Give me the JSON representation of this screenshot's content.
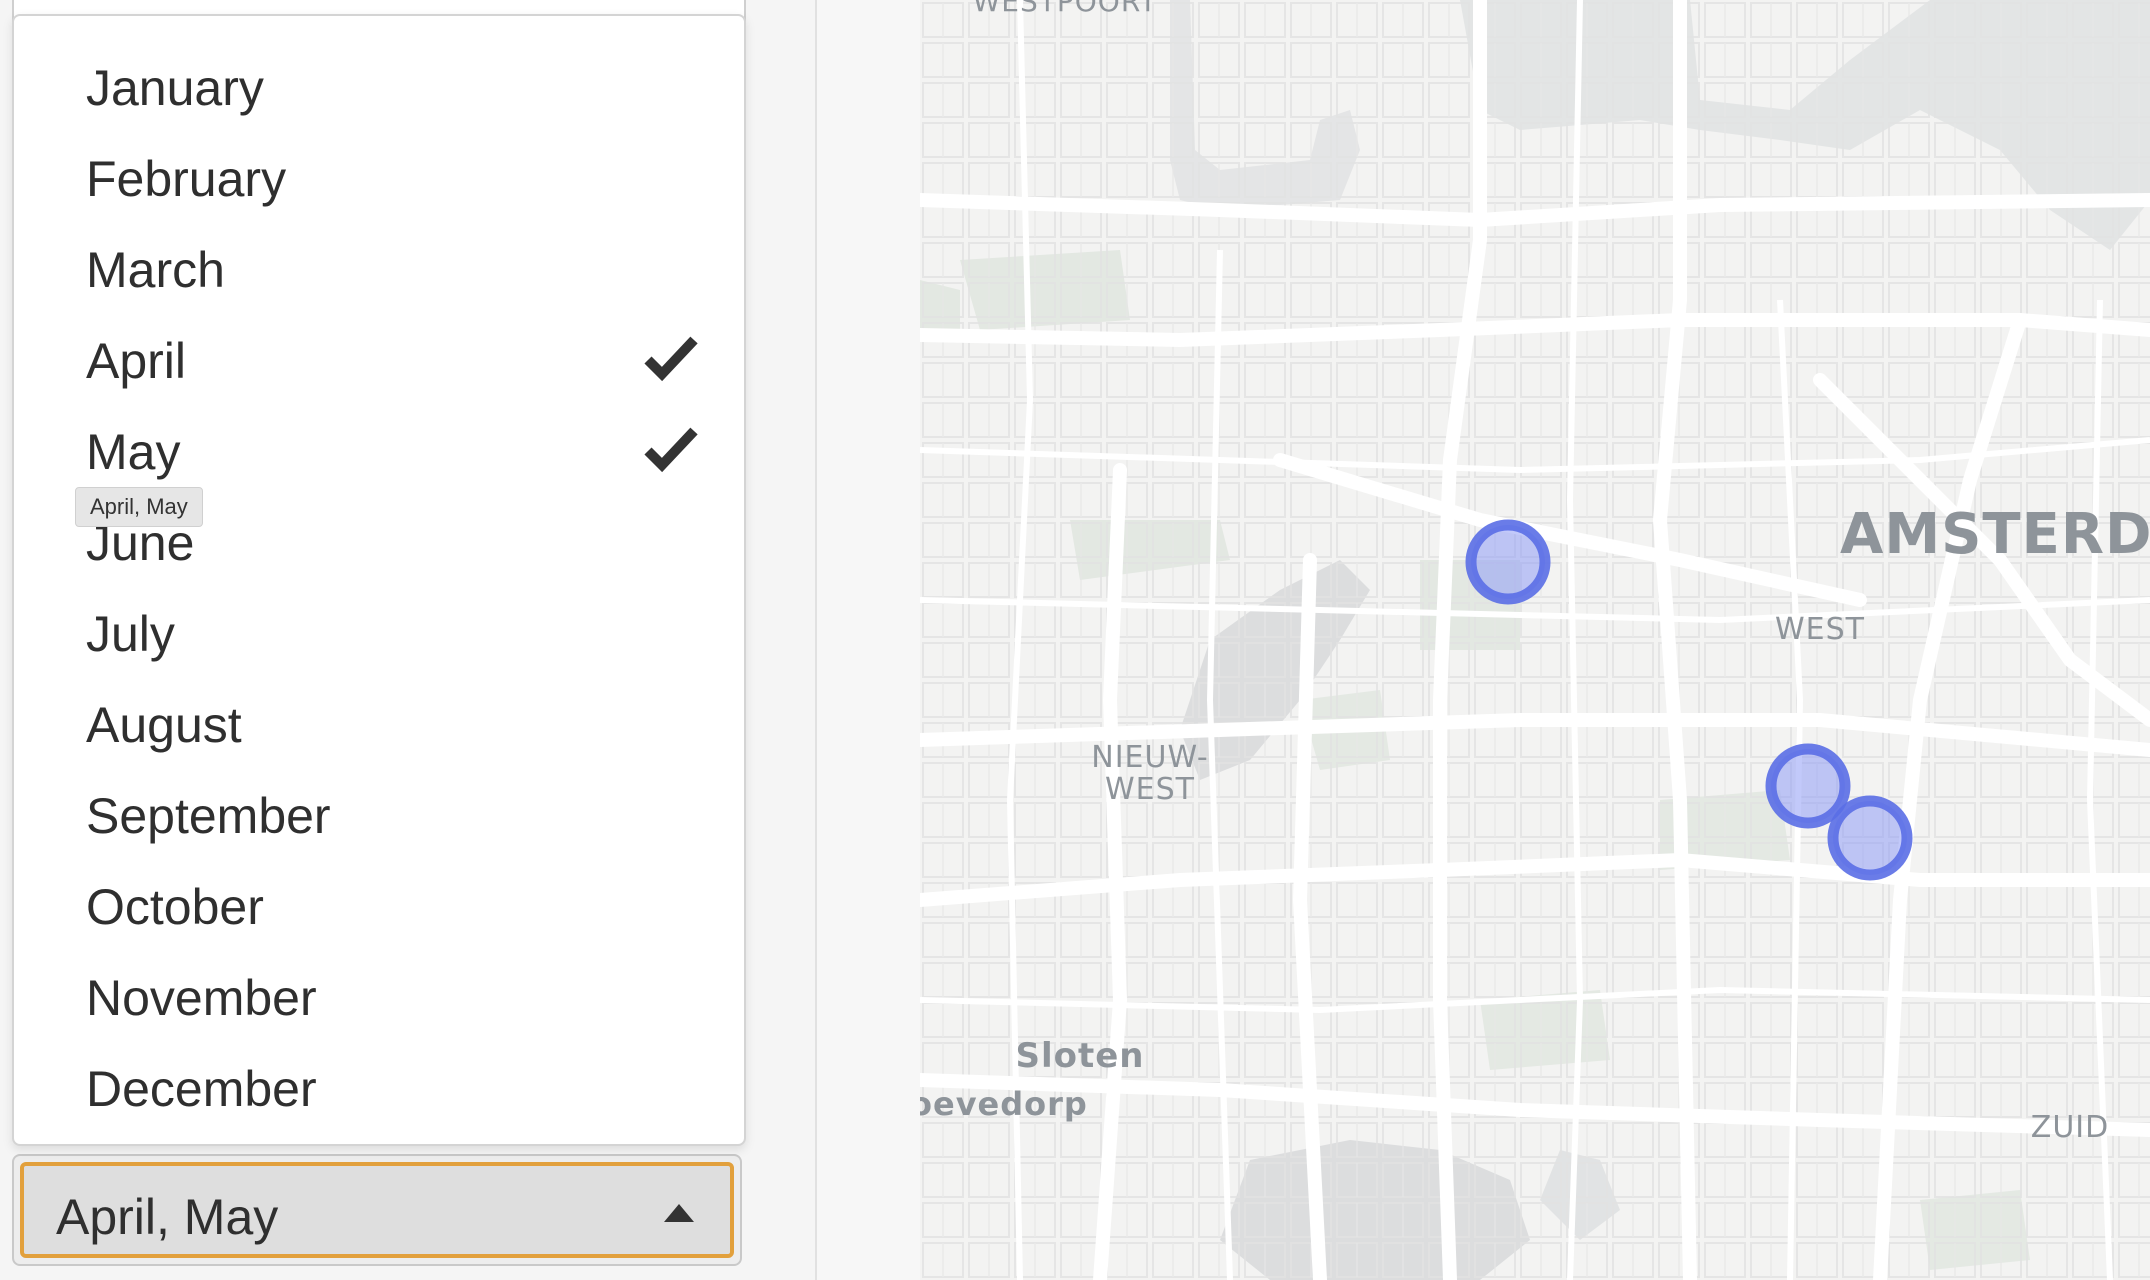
{
  "month_filter": {
    "options": [
      {
        "label": "January",
        "selected": false
      },
      {
        "label": "February",
        "selected": false
      },
      {
        "label": "March",
        "selected": false
      },
      {
        "label": "April",
        "selected": true
      },
      {
        "label": "May",
        "selected": true
      },
      {
        "label": "June",
        "selected": false
      },
      {
        "label": "July",
        "selected": false
      },
      {
        "label": "August",
        "selected": false
      },
      {
        "label": "September",
        "selected": false
      },
      {
        "label": "October",
        "selected": false
      },
      {
        "label": "November",
        "selected": false
      },
      {
        "label": "December",
        "selected": false
      }
    ],
    "tooltip": "April, May",
    "selected_value": "April, May",
    "check_icon": "checkmark-icon",
    "caret_icon": "caret-up-icon",
    "focus_color": "#e2a03c"
  },
  "map": {
    "labels": {
      "westpoort": "WESTPOORT",
      "amsterdam": "AMSTERDA",
      "west": "WEST",
      "nieuw_west": "NIEUW-\nWEST",
      "sloten": "Sloten",
      "osdorp": "oevedorp",
      "zuid": "ZUID"
    },
    "marker_color": "#5a6ee6",
    "marker_count": 3
  }
}
